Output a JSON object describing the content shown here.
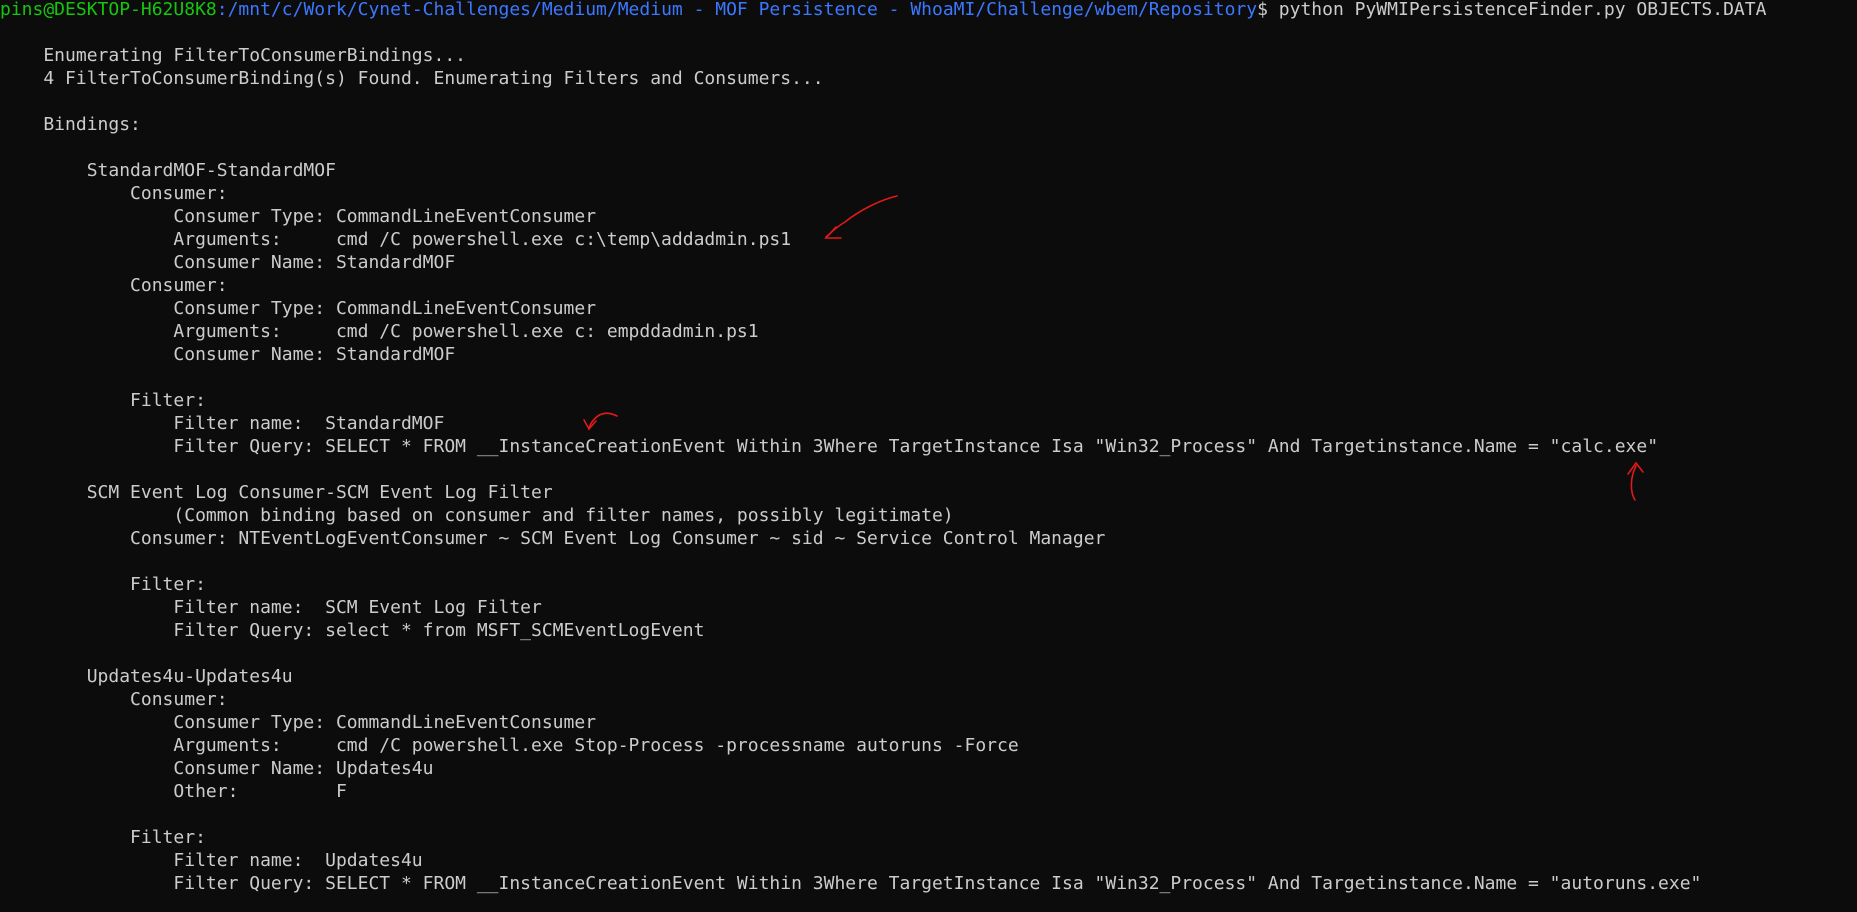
{
  "prompt": {
    "user_host": "pins@DESKTOP-H62U8K8",
    "path": ":/mnt/c/Work/Cynet-Challenges/Medium/Medium - MOF Persistence - WhoaMI/Challenge/wbem/Repository",
    "symbol": "$",
    "command": " python PyWMIPersistenceFinder.py OBJECTS.DATA"
  },
  "output_lines": [
    "",
    "    Enumerating FilterToConsumerBindings...",
    "    4 FilterToConsumerBinding(s) Found. Enumerating Filters and Consumers...",
    "",
    "    Bindings:",
    "",
    "        StandardMOF-StandardMOF",
    "            Consumer:",
    "                Consumer Type: CommandLineEventConsumer",
    "                Arguments:     cmd /C powershell.exe c:\\temp\\addadmin.ps1",
    "                Consumer Name: StandardMOF",
    "            Consumer:",
    "                Consumer Type: CommandLineEventConsumer",
    "                Arguments:     cmd /C powershell.exe c: empddadmin.ps1",
    "                Consumer Name: StandardMOF",
    "",
    "            Filter:",
    "                Filter name:  StandardMOF",
    "                Filter Query: SELECT * FROM __InstanceCreationEvent Within 3Where TargetInstance Isa \"Win32_Process\" And Targetinstance.Name = \"calc.exe\"",
    "",
    "        SCM Event Log Consumer-SCM Event Log Filter",
    "                (Common binding based on consumer and filter names, possibly legitimate)",
    "            Consumer: NTEventLogEventConsumer ~ SCM Event Log Consumer ~ sid ~ Service Control Manager",
    "",
    "            Filter:",
    "                Filter name:  SCM Event Log Filter",
    "                Filter Query: select * from MSFT_SCMEventLogEvent",
    "",
    "        Updates4u-Updates4u",
    "            Consumer:",
    "                Consumer Type: CommandLineEventConsumer",
    "                Arguments:     cmd /C powershell.exe Stop-Process -processname autoruns -Force",
    "                Consumer Name: Updates4u",
    "                Other:         F",
    "",
    "            Filter:",
    "                Filter name:  Updates4u",
    "                Filter Query: SELECT * FROM __InstanceCreationEvent Within 3Where TargetInstance Isa \"Win32_Process\" And Targetinstance.Name = \"autoruns.exe\""
  ],
  "colors": {
    "background": "#0c0c0c",
    "text": "#cccccc",
    "user": "#16c60c",
    "path": "#3b78ff",
    "annotation": "#e0191b"
  }
}
